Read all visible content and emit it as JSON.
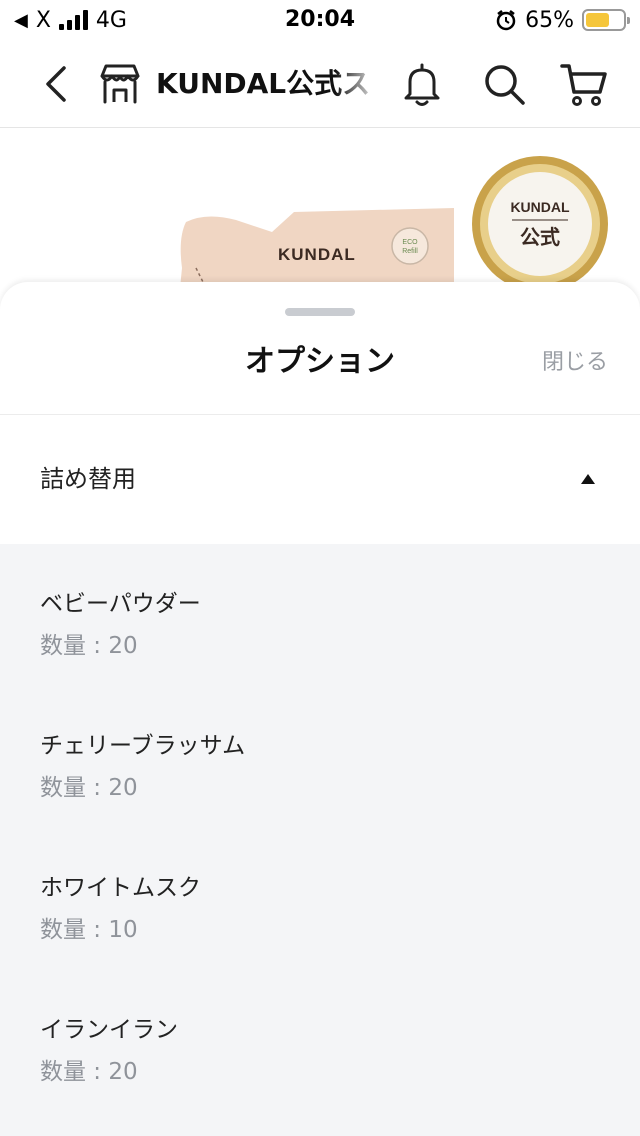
{
  "status_bar": {
    "back_app": "X",
    "network": "4G",
    "time": "20:04",
    "battery_percent": "65%",
    "battery_level": 0.65
  },
  "nav": {
    "title": "KUNDAL公式ス"
  },
  "product": {
    "pouch_brand": "KUNDAL",
    "eco_label_1": "ECO",
    "eco_label_2": "Refill",
    "badge_brand": "KUNDAL",
    "badge_text": "公式"
  },
  "sheet": {
    "title": "オプション",
    "close_label": "閉じる",
    "group_label": "詰め替用",
    "options": [
      {
        "name": "ベビーパウダー",
        "qty": "数量 : 20"
      },
      {
        "name": "チェリーブラッサム",
        "qty": "数量 : 20"
      },
      {
        "name": "ホワイトムスク",
        "qty": "数量 : 10"
      },
      {
        "name": "イランイラン",
        "qty": "数量 : 20"
      }
    ]
  },
  "colors": {
    "accent_battery": "#f5c63b",
    "list_background": "#f4f5f7",
    "muted_text": "#8f939a"
  },
  "icons": [
    "back-arrow-icon",
    "alarm-icon",
    "storefront-icon",
    "bell-icon",
    "search-icon",
    "cart-icon",
    "caret-up-icon"
  ]
}
